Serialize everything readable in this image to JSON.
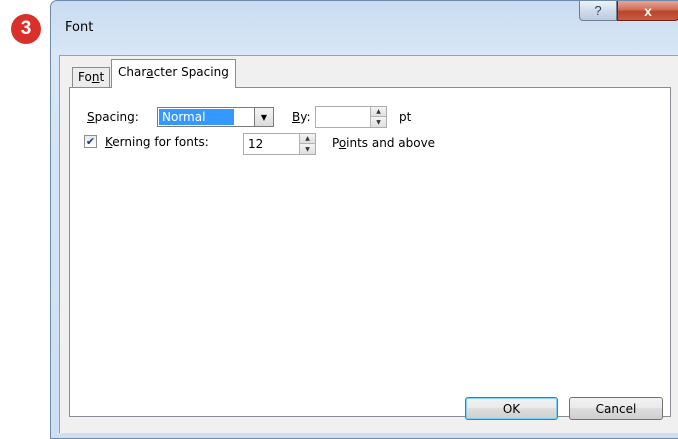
{
  "step_badge": "3",
  "window": {
    "title": "Font",
    "help_label": "?",
    "close_label": "x"
  },
  "tabs": [
    {
      "pre": "Fo",
      "key": "n",
      "post": "t",
      "active": false
    },
    {
      "pre": "Char",
      "key": "a",
      "post": "cter Spacing",
      "active": true
    }
  ],
  "spacing": {
    "label_key": "S",
    "label_rest": "pacing:",
    "value": "Normal",
    "by_key": "B",
    "by_rest": "y:",
    "by_value": "",
    "unit": "pt"
  },
  "kerning": {
    "checked": true,
    "label_key": "K",
    "label_rest": "erning for fonts:",
    "value": "12",
    "suffix_pre": "P",
    "suffix_key": "o",
    "suffix_post": "ints and above"
  },
  "buttons": {
    "ok": "OK",
    "cancel": "Cancel"
  }
}
